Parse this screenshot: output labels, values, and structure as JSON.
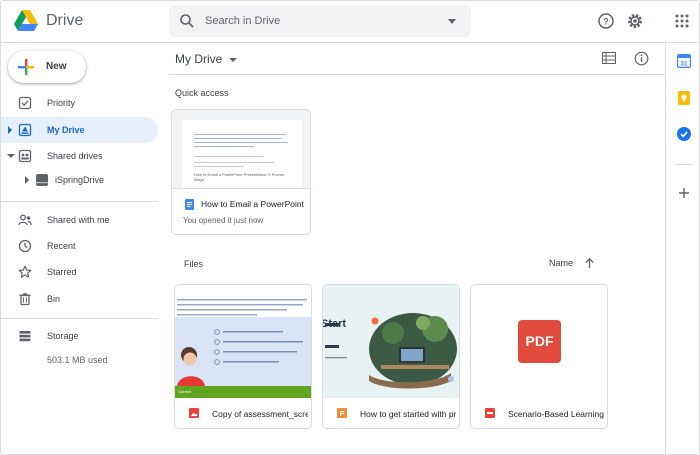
{
  "header": {
    "app_name": "Drive",
    "search_placeholder": "Search in Drive",
    "icons": [
      "drive-logo",
      "search-icon",
      "search-options-icon",
      "help-icon",
      "settings-icon",
      "apps-icon"
    ]
  },
  "sidebar": {
    "new_label": "New",
    "items": [
      {
        "label": "Priority",
        "icon": "priority-icon"
      },
      {
        "label": "My Drive",
        "icon": "my-drive-icon",
        "active": true
      },
      {
        "label": "Shared drives",
        "icon": "shared-drives-icon"
      },
      {
        "label": "iSpringDrive",
        "icon": "drive-folder-icon"
      },
      {
        "label": "Shared with me",
        "icon": "shared-with-me-icon"
      },
      {
        "label": "Recent",
        "icon": "clock-icon"
      },
      {
        "label": "Starred",
        "icon": "star-icon"
      },
      {
        "label": "Bin",
        "icon": "trash-icon"
      },
      {
        "label": "Storage",
        "icon": "storage-icon"
      }
    ],
    "storage_used": "503.1 MB used"
  },
  "main": {
    "title": "My Drive",
    "quick_access_label": "Quick access",
    "quick_access": [
      {
        "name": "How to Email a PowerPoint Presentation",
        "subtitle": "You opened it just now",
        "thumb_title": "How to Email a PowerPoint Presentation: 5 Proven Ways"
      }
    ],
    "files_label": "Files",
    "sort_label": "Name",
    "files": [
      {
        "name": "Copy of assessment_screenshot.png",
        "icon": "image-file-icon",
        "thumb_text": "Correct"
      },
      {
        "name": "How to get started with presentation",
        "icon": "slides-file-icon",
        "thumb_text": "Start"
      },
      {
        "name": "Scenario-Based Learning.pdf",
        "icon": "pdf-file-icon",
        "thumb_text": "PDF"
      }
    ]
  },
  "colors": {
    "accent": "#1a73e8",
    "active_bg": "#e8f0fe",
    "docs_blue": "#4285f4",
    "pdf_red": "#ea4335",
    "slides_orange": "#f4b400"
  }
}
